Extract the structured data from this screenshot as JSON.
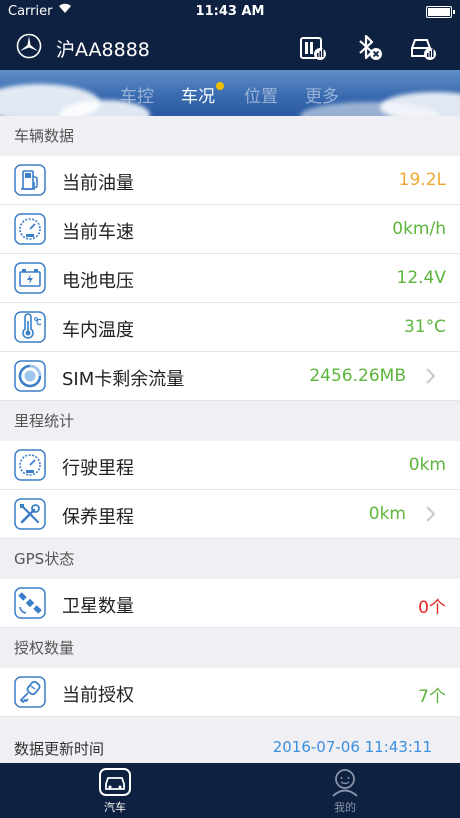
{
  "status_bar": {
    "carrier": "Carrier",
    "time": "11:43 AM"
  },
  "header": {
    "plate": "沪AA8888"
  },
  "tabs": [
    {
      "label": "车控"
    },
    {
      "label": "车况"
    },
    {
      "label": "位置"
    },
    {
      "label": "更多"
    }
  ],
  "sections": {
    "vehicle": "车辆数据",
    "mileage": "里程统计",
    "gps": "GPS状态",
    "auth": "授权数量"
  },
  "rows": {
    "fuel": {
      "label": "当前油量",
      "value": "19.2L"
    },
    "speed": {
      "label": "当前车速",
      "value": "0km/h"
    },
    "battery": {
      "label": "电池电压",
      "value": "12.4V"
    },
    "temp": {
      "label": "车内温度",
      "value": "31°C"
    },
    "sim": {
      "label": "SIM卡剩余流量",
      "value": "2456.26MB"
    },
    "driving": {
      "label": "行驶里程",
      "value": "0km"
    },
    "maintenance": {
      "label": "保养里程",
      "value": "0km"
    },
    "satellite": {
      "label": "卫星数量",
      "value": "0个"
    },
    "authorization": {
      "label": "当前授权",
      "value": "7个"
    }
  },
  "update": {
    "label": "数据更新时间",
    "value": "2016-07-06 11:43:11"
  },
  "tabbar": [
    {
      "label": "汽车"
    },
    {
      "label": "我的"
    }
  ],
  "colors": {
    "nav_bg": "#0e2140",
    "green": "#5cb53c",
    "orange": "#f0a830",
    "red": "#e8251e",
    "blue": "#3b8fe0"
  }
}
